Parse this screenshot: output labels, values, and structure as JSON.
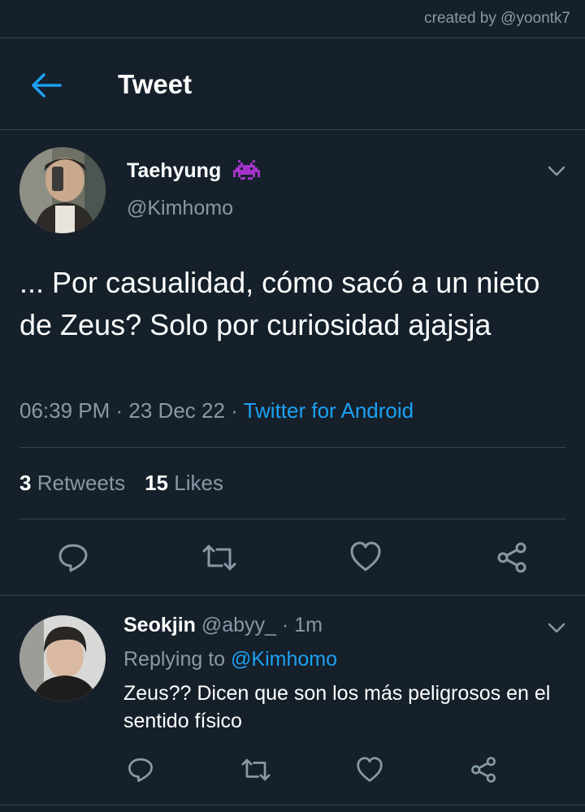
{
  "watermark": "created by @yoontk7",
  "header": {
    "title": "Tweet"
  },
  "tweet": {
    "author_name": "Taehyung",
    "author_handle": "@Kimhomo",
    "text": "... Por casualidad, cómo sacó a un nieto de Zeus? Solo por curiosidad ajajsja",
    "time": "06:39 PM",
    "date": "23 Dec 22",
    "separator": " · ",
    "source": "Twitter for Android",
    "retweets_count": "3",
    "retweets_label": "Retweets",
    "likes_count": "15",
    "likes_label": "Likes",
    "icons": [
      "space-invader-icon",
      "chevron-down-icon",
      "reply-icon",
      "retweet-icon",
      "like-icon",
      "share-icon"
    ]
  },
  "reply": {
    "name": "Seokjin",
    "handle": "@abyy_",
    "separator": " · ",
    "time": "1m",
    "replying_to_label": "Replying to",
    "replying_to_handle": "@Kimhomo",
    "text": "Zeus?? Dicen que son los más peligrosos en el sentido físico"
  },
  "colors": {
    "background": "#15202b",
    "accent": "#1da1f2",
    "secondary_text": "#8899a6",
    "divider": "#38444d",
    "invader": "#a333c8"
  }
}
